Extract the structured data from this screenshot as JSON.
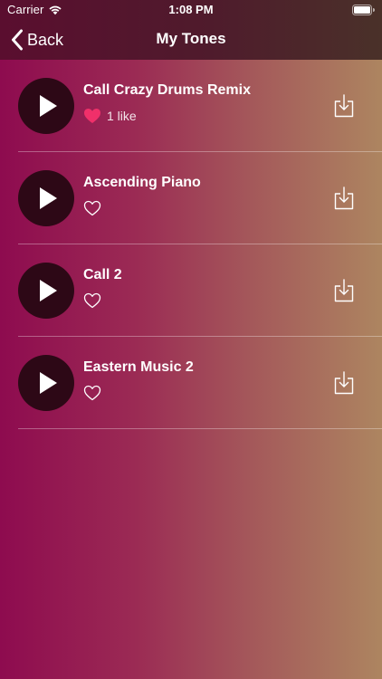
{
  "status_bar": {
    "carrier": "Carrier",
    "time": "1:08 PM"
  },
  "nav": {
    "back_label": "Back",
    "title": "My Tones"
  },
  "tones": [
    {
      "title": "Call Crazy Drums Remix",
      "liked": true,
      "likes_label": "1 like"
    },
    {
      "title": "Ascending Piano",
      "liked": false,
      "likes_label": ""
    },
    {
      "title": "Call 2",
      "liked": false,
      "likes_label": ""
    },
    {
      "title": "Eastern Music 2",
      "liked": false,
      "likes_label": ""
    }
  ],
  "colors": {
    "liked_heart": "#f0306a",
    "play_button_bg": "#2d0816",
    "gradient_left": "#8e0b4f",
    "gradient_right": "#ad8560"
  },
  "icons": {
    "back": "chevron-left-icon",
    "play": "play-icon",
    "like": "heart-icon",
    "download": "download-icon",
    "wifi": "wifi-icon",
    "battery": "battery-icon"
  }
}
